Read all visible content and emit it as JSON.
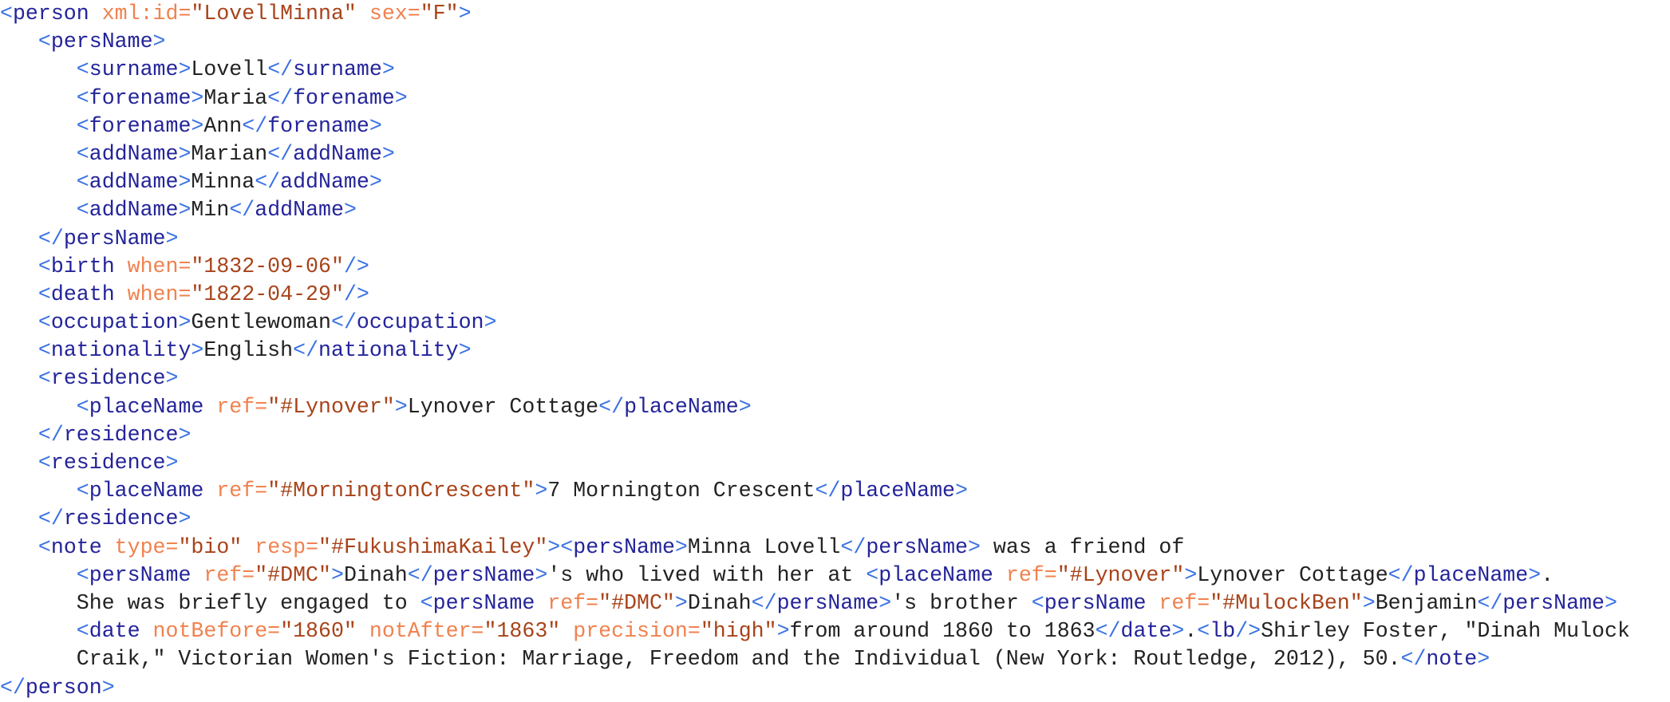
{
  "document": {
    "type": "TEI XML person record",
    "colors": {
      "bracket": "#3b73e3",
      "tag": "#24249a",
      "attr": "#f0824f",
      "value": "#a8431a",
      "text": "#222222"
    },
    "lines": [
      {
        "depth": 0,
        "tokens": [
          [
            "bracket",
            "<"
          ],
          [
            "tag",
            "person"
          ],
          [
            "space",
            " "
          ],
          [
            "attr",
            "xml:id="
          ],
          [
            "value",
            "\"LovellMinna\""
          ],
          [
            "space",
            " "
          ],
          [
            "attr",
            "sex="
          ],
          [
            "value",
            "\"F\""
          ],
          [
            "bracket",
            ">"
          ]
        ]
      },
      {
        "depth": 1,
        "tokens": [
          [
            "bracket",
            "<"
          ],
          [
            "tag",
            "persName"
          ],
          [
            "bracket",
            ">"
          ]
        ]
      },
      {
        "depth": 2,
        "tokens": [
          [
            "bracket",
            "<"
          ],
          [
            "tag",
            "surname"
          ],
          [
            "bracket",
            ">"
          ],
          [
            "text",
            "Lovell"
          ],
          [
            "bracket",
            "</"
          ],
          [
            "tag",
            "surname"
          ],
          [
            "bracket",
            ">"
          ]
        ]
      },
      {
        "depth": 2,
        "tokens": [
          [
            "bracket",
            "<"
          ],
          [
            "tag",
            "forename"
          ],
          [
            "bracket",
            ">"
          ],
          [
            "text",
            "Maria"
          ],
          [
            "bracket",
            "</"
          ],
          [
            "tag",
            "forename"
          ],
          [
            "bracket",
            ">"
          ]
        ]
      },
      {
        "depth": 2,
        "tokens": [
          [
            "bracket",
            "<"
          ],
          [
            "tag",
            "forename"
          ],
          [
            "bracket",
            ">"
          ],
          [
            "text",
            "Ann"
          ],
          [
            "bracket",
            "</"
          ],
          [
            "tag",
            "forename"
          ],
          [
            "bracket",
            ">"
          ]
        ]
      },
      {
        "depth": 2,
        "tokens": [
          [
            "bracket",
            "<"
          ],
          [
            "tag",
            "addName"
          ],
          [
            "bracket",
            ">"
          ],
          [
            "text",
            "Marian"
          ],
          [
            "bracket",
            "</"
          ],
          [
            "tag",
            "addName"
          ],
          [
            "bracket",
            ">"
          ]
        ]
      },
      {
        "depth": 2,
        "tokens": [
          [
            "bracket",
            "<"
          ],
          [
            "tag",
            "addName"
          ],
          [
            "bracket",
            ">"
          ],
          [
            "text",
            "Minna"
          ],
          [
            "bracket",
            "</"
          ],
          [
            "tag",
            "addName"
          ],
          [
            "bracket",
            ">"
          ]
        ]
      },
      {
        "depth": 2,
        "tokens": [
          [
            "bracket",
            "<"
          ],
          [
            "tag",
            "addName"
          ],
          [
            "bracket",
            ">"
          ],
          [
            "text",
            "Min"
          ],
          [
            "bracket",
            "</"
          ],
          [
            "tag",
            "addName"
          ],
          [
            "bracket",
            ">"
          ]
        ]
      },
      {
        "depth": 1,
        "tokens": [
          [
            "bracket",
            "</"
          ],
          [
            "tag",
            "persName"
          ],
          [
            "bracket",
            ">"
          ]
        ]
      },
      {
        "depth": 1,
        "tokens": [
          [
            "bracket",
            "<"
          ],
          [
            "tag",
            "birth"
          ],
          [
            "space",
            " "
          ],
          [
            "attr",
            "when="
          ],
          [
            "value",
            "\"1832-09-06\""
          ],
          [
            "bracket",
            "/>"
          ]
        ]
      },
      {
        "depth": 1,
        "tokens": [
          [
            "bracket",
            "<"
          ],
          [
            "tag",
            "death"
          ],
          [
            "space",
            " "
          ],
          [
            "attr",
            "when="
          ],
          [
            "value",
            "\"1822-04-29\""
          ],
          [
            "bracket",
            "/>"
          ]
        ]
      },
      {
        "depth": 1,
        "tokens": [
          [
            "bracket",
            "<"
          ],
          [
            "tag",
            "occupation"
          ],
          [
            "bracket",
            ">"
          ],
          [
            "text",
            "Gentlewoman"
          ],
          [
            "bracket",
            "</"
          ],
          [
            "tag",
            "occupation"
          ],
          [
            "bracket",
            ">"
          ]
        ]
      },
      {
        "depth": 1,
        "tokens": [
          [
            "bracket",
            "<"
          ],
          [
            "tag",
            "nationality"
          ],
          [
            "bracket",
            ">"
          ],
          [
            "text",
            "English"
          ],
          [
            "bracket",
            "</"
          ],
          [
            "tag",
            "nationality"
          ],
          [
            "bracket",
            ">"
          ]
        ]
      },
      {
        "depth": 1,
        "tokens": [
          [
            "bracket",
            "<"
          ],
          [
            "tag",
            "residence"
          ],
          [
            "bracket",
            ">"
          ]
        ]
      },
      {
        "depth": 2,
        "tokens": [
          [
            "bracket",
            "<"
          ],
          [
            "tag",
            "placeName"
          ],
          [
            "space",
            " "
          ],
          [
            "attr",
            "ref="
          ],
          [
            "value",
            "\"#Lynover\""
          ],
          [
            "bracket",
            ">"
          ],
          [
            "text",
            "Lynover Cottage"
          ],
          [
            "bracket",
            "</"
          ],
          [
            "tag",
            "placeName"
          ],
          [
            "bracket",
            ">"
          ]
        ]
      },
      {
        "depth": 1,
        "tokens": [
          [
            "bracket",
            "</"
          ],
          [
            "tag",
            "residence"
          ],
          [
            "bracket",
            ">"
          ]
        ]
      },
      {
        "depth": 1,
        "tokens": [
          [
            "bracket",
            "<"
          ],
          [
            "tag",
            "residence"
          ],
          [
            "bracket",
            ">"
          ]
        ]
      },
      {
        "depth": 2,
        "tokens": [
          [
            "bracket",
            "<"
          ],
          [
            "tag",
            "placeName"
          ],
          [
            "space",
            " "
          ],
          [
            "attr",
            "ref="
          ],
          [
            "value",
            "\"#MorningtonCrescent\""
          ],
          [
            "bracket",
            ">"
          ],
          [
            "text",
            "7 Mornington Crescent"
          ],
          [
            "bracket",
            "</"
          ],
          [
            "tag",
            "placeName"
          ],
          [
            "bracket",
            ">"
          ]
        ]
      },
      {
        "depth": 1,
        "tokens": [
          [
            "bracket",
            "</"
          ],
          [
            "tag",
            "residence"
          ],
          [
            "bracket",
            ">"
          ]
        ]
      },
      {
        "depth": 1,
        "tokens": [
          [
            "bracket",
            "<"
          ],
          [
            "tag",
            "note"
          ],
          [
            "space",
            " "
          ],
          [
            "attr",
            "type="
          ],
          [
            "value",
            "\"bio\""
          ],
          [
            "space",
            " "
          ],
          [
            "attr",
            "resp="
          ],
          [
            "value",
            "\"#FukushimaKailey\""
          ],
          [
            "bracket",
            ">"
          ],
          [
            "bracket",
            "<"
          ],
          [
            "tag",
            "persName"
          ],
          [
            "bracket",
            ">"
          ],
          [
            "text",
            "Minna Lovell"
          ],
          [
            "bracket",
            "</"
          ],
          [
            "tag",
            "persName"
          ],
          [
            "bracket",
            ">"
          ],
          [
            "text",
            " was a friend of"
          ]
        ]
      },
      {
        "depth": 2,
        "tokens": [
          [
            "bracket",
            "<"
          ],
          [
            "tag",
            "persName"
          ],
          [
            "space",
            " "
          ],
          [
            "attr",
            "ref="
          ],
          [
            "value",
            "\"#DMC\""
          ],
          [
            "bracket",
            ">"
          ],
          [
            "text",
            "Dinah"
          ],
          [
            "bracket",
            "</"
          ],
          [
            "tag",
            "persName"
          ],
          [
            "bracket",
            ">"
          ],
          [
            "text",
            "'s who lived with her at "
          ],
          [
            "bracket",
            "<"
          ],
          [
            "tag",
            "placeName"
          ],
          [
            "space",
            " "
          ],
          [
            "attr",
            "ref="
          ],
          [
            "value",
            "\"#Lynover\""
          ],
          [
            "bracket",
            ">"
          ],
          [
            "text",
            "Lynover Cottage"
          ],
          [
            "bracket",
            "</"
          ],
          [
            "tag",
            "placeName"
          ],
          [
            "bracket",
            ">"
          ],
          [
            "text",
            "."
          ]
        ]
      },
      {
        "depth": 2,
        "tokens": [
          [
            "text",
            "She was briefly engaged to "
          ],
          [
            "bracket",
            "<"
          ],
          [
            "tag",
            "persName"
          ],
          [
            "space",
            " "
          ],
          [
            "attr",
            "ref="
          ],
          [
            "value",
            "\"#DMC\""
          ],
          [
            "bracket",
            ">"
          ],
          [
            "text",
            "Dinah"
          ],
          [
            "bracket",
            "</"
          ],
          [
            "tag",
            "persName"
          ],
          [
            "bracket",
            ">"
          ],
          [
            "text",
            "'s brother "
          ],
          [
            "bracket",
            "<"
          ],
          [
            "tag",
            "persName"
          ],
          [
            "space",
            " "
          ],
          [
            "attr",
            "ref="
          ],
          [
            "value",
            "\"#MulockBen\""
          ],
          [
            "bracket",
            ">"
          ],
          [
            "text",
            "Benjamin"
          ],
          [
            "bracket",
            "</"
          ],
          [
            "tag",
            "persName"
          ],
          [
            "bracket",
            ">"
          ]
        ]
      },
      {
        "depth": 2,
        "tokens": [
          [
            "bracket",
            "<"
          ],
          [
            "tag",
            "date"
          ],
          [
            "space",
            " "
          ],
          [
            "attr",
            "notBefore="
          ],
          [
            "value",
            "\"1860\""
          ],
          [
            "space",
            " "
          ],
          [
            "attr",
            "notAfter="
          ],
          [
            "value",
            "\"1863\""
          ],
          [
            "space",
            " "
          ],
          [
            "attr",
            "precision="
          ],
          [
            "value",
            "\"high\""
          ],
          [
            "bracket",
            ">"
          ],
          [
            "text",
            "from around 1860 to 1863"
          ],
          [
            "bracket",
            "</"
          ],
          [
            "tag",
            "date"
          ],
          [
            "bracket",
            ">"
          ],
          [
            "text",
            "."
          ],
          [
            "bracket",
            "<"
          ],
          [
            "tag",
            "lb"
          ],
          [
            "bracket",
            "/>"
          ],
          [
            "text",
            "Shirley Foster, \"Dinah Mulock"
          ]
        ]
      },
      {
        "depth": 2,
        "tokens": [
          [
            "text",
            "Craik,\" Victorian Women's Fiction: Marriage, Freedom and the Individual (New York: Routledge, 2012), 50."
          ],
          [
            "bracket",
            "</"
          ],
          [
            "tag",
            "note"
          ],
          [
            "bracket",
            ">"
          ]
        ]
      },
      {
        "depth": 0,
        "tokens": [
          [
            "bracket",
            "</"
          ],
          [
            "tag",
            "person"
          ],
          [
            "bracket",
            ">"
          ]
        ]
      }
    ]
  }
}
